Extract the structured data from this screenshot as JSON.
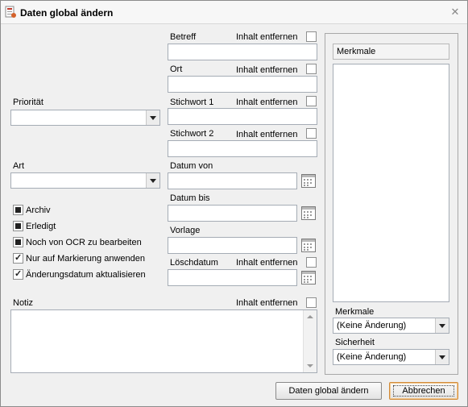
{
  "window": {
    "title": "Daten global ändern"
  },
  "fields": {
    "betreff": {
      "label": "Betreff",
      "clear_label": "Inhalt entfernen",
      "value": ""
    },
    "ort": {
      "label": "Ort",
      "clear_label": "Inhalt entfernen",
      "value": ""
    },
    "stichwort1": {
      "label": "Stichwort 1",
      "clear_label": "Inhalt entfernen",
      "value": ""
    },
    "stichwort2": {
      "label": "Stichwort 2",
      "clear_label": "Inhalt entfernen",
      "value": ""
    },
    "datum_von": {
      "label": "Datum von",
      "value": ""
    },
    "datum_bis": {
      "label": "Datum bis",
      "value": ""
    },
    "vorlage": {
      "label": "Vorlage",
      "value": ""
    },
    "loeschdatum": {
      "label": "Löschdatum",
      "clear_label": "Inhalt entfernen",
      "value": ""
    },
    "notiz": {
      "label": "Notiz",
      "clear_label": "Inhalt entfernen",
      "value": ""
    }
  },
  "combos": {
    "prioritaet": {
      "label": "Priorität",
      "value": ""
    },
    "art": {
      "label": "Art",
      "value": ""
    },
    "merkmale": {
      "label": "Merkmale",
      "value": "(Keine Änderung)"
    },
    "sicherheit": {
      "label": "Sicherheit",
      "value": "(Keine Änderung)"
    }
  },
  "checkboxes": [
    {
      "label": "Archiv",
      "state": "indeterminate"
    },
    {
      "label": "Erledigt",
      "state": "indeterminate"
    },
    {
      "label": "Noch von OCR zu bearbeiten",
      "state": "indeterminate"
    },
    {
      "label": "Nur auf Markierung anwenden",
      "state": "checked"
    },
    {
      "label": "Änderungsdatum aktualisieren",
      "state": "checked"
    }
  ],
  "merkmale_panel": {
    "header": "Merkmale"
  },
  "buttons": {
    "apply": "Daten global ändern",
    "cancel": "Abbrechen"
  }
}
